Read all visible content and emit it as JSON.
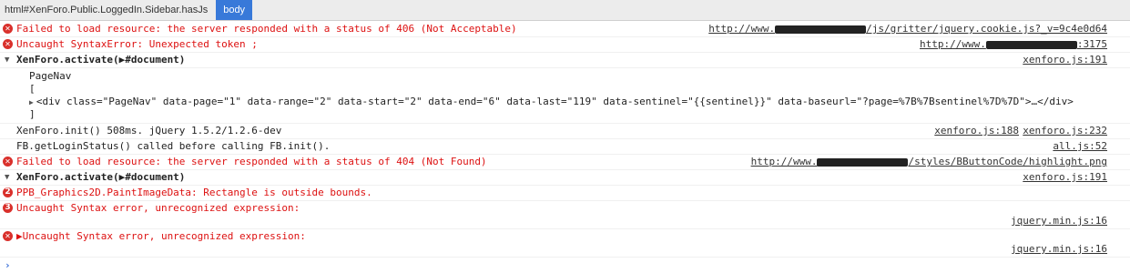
{
  "breadcrumbs": [
    "html#XenForo.Public.LoggedIn.Sidebar.hasJs",
    "body"
  ],
  "rows": [
    {
      "text": "Failed to load resource: the server responded with a status of 406 (Not Acceptable)",
      "src_a": "http://www.",
      "src_b": "/js/gritter/jquery.cookie.js?_v=9c4e0d64"
    },
    {
      "text": "Uncaught SyntaxError: Unexpected token ;",
      "src_a": "http://www.",
      "src_b": ":3175"
    },
    {
      "text": "XenForo.activate(▶#document)",
      "src": "xenforo.js:191"
    },
    {
      "group": [
        "PageNav",
        "[",
        "<div class=\"PageNav\" data-page=\"1\" data-range=\"2\" data-start=\"2\" data-end=\"6\" data-last=\"119\" data-sentinel=\"{{sentinel}}\" data-baseurl=\"?page=%7B%7Bsentinel%7D%7D\">…</div>",
        "]"
      ]
    },
    {
      "text": "XenForo.init() 508ms. jQuery 1.5.2/1.2.6-dev",
      "src": "xenforo.js:232",
      "src2": "xenforo.js:188"
    },
    {
      "text": "FB.getLoginStatus() called before calling FB.init().",
      "src": "all.js:52"
    },
    {
      "text": "Failed to load resource: the server responded with a status of 404 (Not Found)",
      "src_a": "http://www.",
      "src_b": "/styles/BButtonCode/highlight.png"
    },
    {
      "text": "XenForo.activate(▶#document)",
      "src": "xenforo.js:191"
    },
    {
      "text": "PPB_Graphics2D.PaintImageData: Rectangle is outside bounds.",
      "count": "2"
    },
    {
      "text": "Uncaught Syntax error, unrecognized expression:",
      "count": "3",
      "src": "jquery.min.js:16"
    },
    {
      "text": "▶Uncaught Syntax error, unrecognized expression:",
      "src": "jquery.min.js:16"
    }
  ],
  "prompt": "›"
}
